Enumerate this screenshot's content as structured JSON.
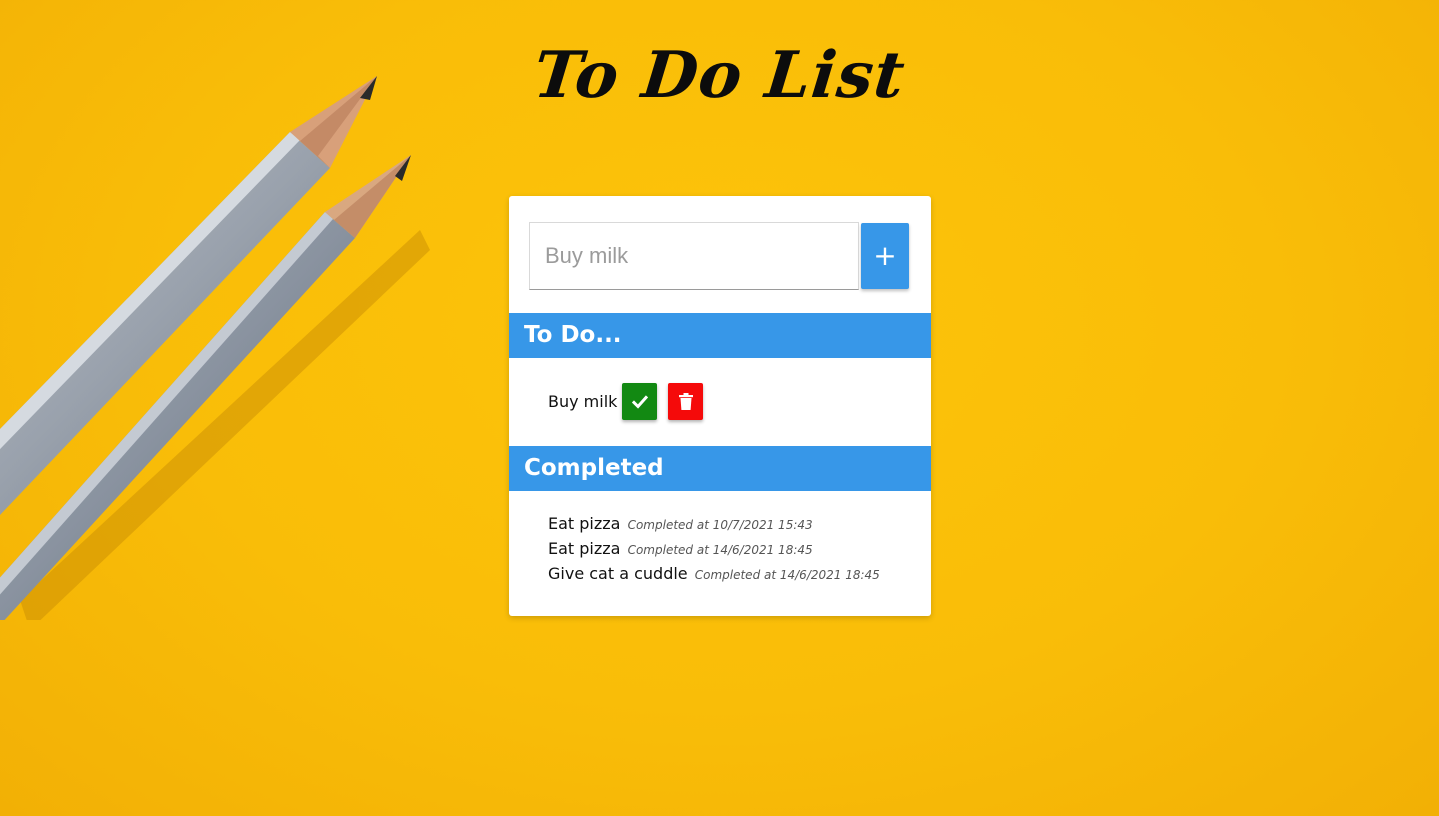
{
  "page": {
    "title": "To Do List"
  },
  "input": {
    "placeholder": "Buy milk",
    "add_label": "+"
  },
  "todo": {
    "header": "To Do...",
    "items": [
      {
        "text": "Buy milk",
        "check_icon": "check-icon",
        "delete_icon": "trash-icon"
      }
    ]
  },
  "completed": {
    "header": "Completed",
    "items": [
      {
        "text": "Eat pizza",
        "time": "Completed at 10/7/2021 15:43"
      },
      {
        "text": "Eat pizza",
        "time": "Completed at 14/6/2021 18:45"
      },
      {
        "text": "Give cat a cuddle",
        "time": "Completed at 14/6/2021 18:45"
      }
    ]
  },
  "colors": {
    "background": "#fbbf0b",
    "accent": "#3797e8",
    "complete": "#128912",
    "delete": "#f50a0a"
  }
}
